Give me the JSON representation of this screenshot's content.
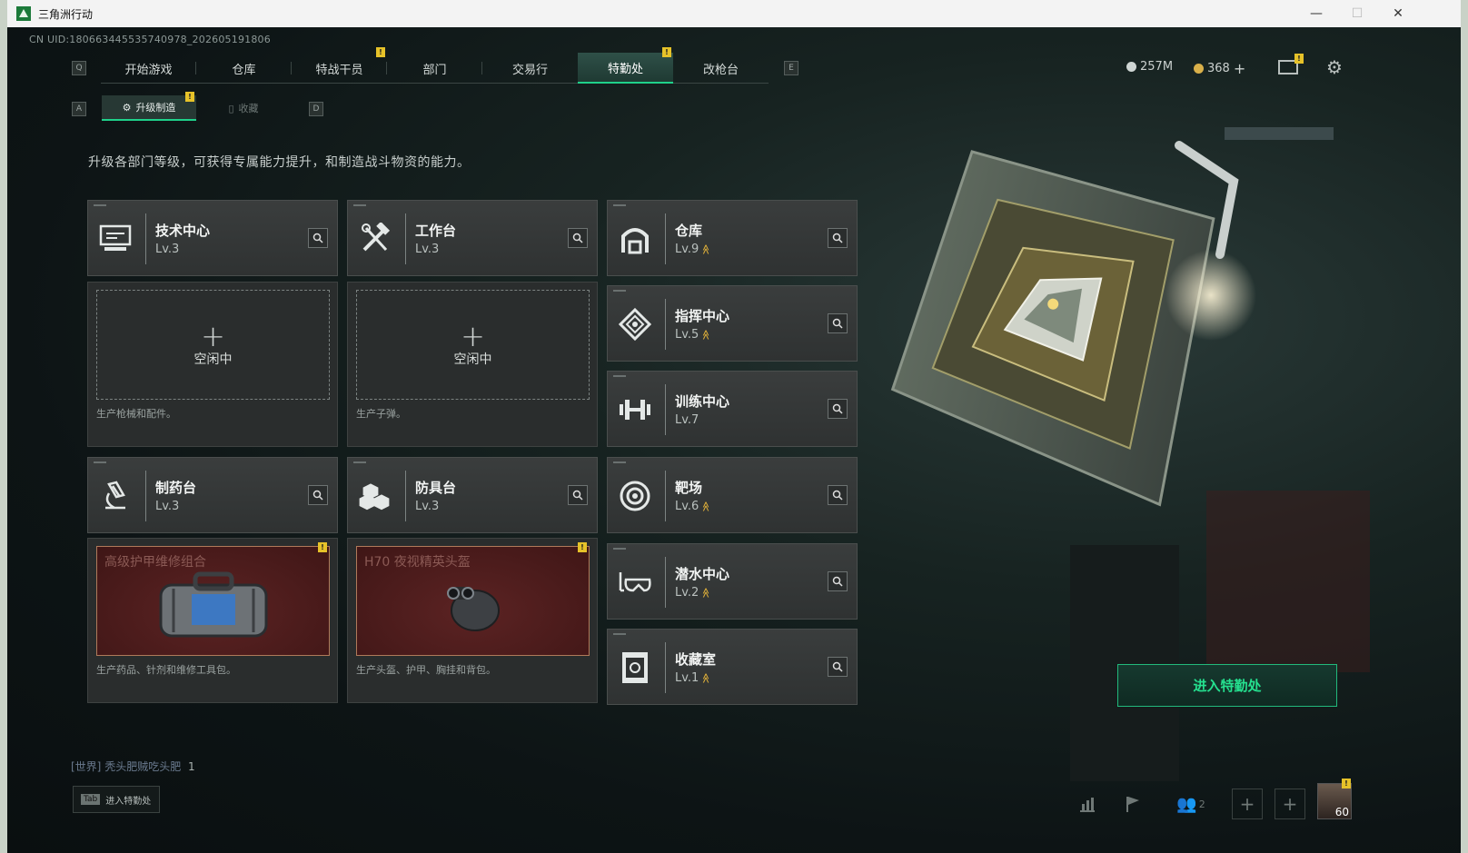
{
  "window": {
    "title": "三角洲行动",
    "minimize": "—",
    "maximize": "☐",
    "close": "✕"
  },
  "uid": "CN UID:18066344553574097​8_202605191806",
  "nav": {
    "left_key": "Q",
    "right_key": "E",
    "tabs": [
      {
        "label": "开始游戏"
      },
      {
        "label": "仓库"
      },
      {
        "label": "特战干员"
      },
      {
        "label": "部门"
      },
      {
        "label": "交易行"
      },
      {
        "label": "特勤处"
      },
      {
        "label": "改枪台"
      }
    ],
    "active_index": 5
  },
  "currency": {
    "coin": "257M",
    "points": "368",
    "plus": "+"
  },
  "badge_mark": "!",
  "subnav": {
    "left_key": "A",
    "right_key": "D",
    "tabs": [
      {
        "label": "升级制造"
      },
      {
        "label": "收藏"
      }
    ]
  },
  "description": "升级各部门等级，可获得专属能力提升，和制造战斗物资的能力。",
  "cards": [
    {
      "name": "技术中心",
      "level": "Lv.3",
      "icon": "monitor-icon",
      "upgrade": false
    },
    {
      "name": "工作台",
      "level": "Lv.3",
      "icon": "tools-icon",
      "upgrade": false
    },
    {
      "name": "仓库",
      "level": "Lv.9",
      "icon": "warehouse-icon",
      "upgrade": true
    },
    {
      "name": "指挥中心",
      "level": "Lv.5",
      "icon": "command-icon",
      "upgrade": true
    },
    {
      "name": "训练中心",
      "level": "Lv.7",
      "icon": "dumbbell-icon",
      "upgrade": false
    },
    {
      "name": "制药台",
      "level": "Lv.3",
      "icon": "microscope-icon",
      "upgrade": false
    },
    {
      "name": "防具台",
      "level": "Lv.3",
      "icon": "armor-icon",
      "upgrade": false
    },
    {
      "name": "靶场",
      "level": "Lv.6",
      "icon": "target-icon",
      "upgrade": true
    },
    {
      "name": "潜水中心",
      "level": "Lv.2",
      "icon": "goggles-icon",
      "upgrade": true
    },
    {
      "name": "收藏室",
      "level": "Lv.1",
      "icon": "vault-icon",
      "upgrade": true
    }
  ],
  "slots": {
    "idle_label": "空闲中",
    "plus": "+",
    "tech_caption": "生产枪械和配件。",
    "workbench_caption": "生产子弹。",
    "pharma_product": "高级护甲维修组合",
    "pharma_caption": "生产药品、针剂和维修工具包。",
    "armor_product": "H70 夜视精英头盔",
    "armor_caption": "生产头盔、护甲、胸挂和背包。"
  },
  "upgrade_mark": "≫",
  "enter_button": "进入特勤处",
  "chat": {
    "channel": "[世界]",
    "user": "秃头肥贼吃头肥",
    "message": "1"
  },
  "tab_hint": {
    "key": "Tab",
    "label": "进入特勤处"
  },
  "friends_count": "2",
  "player_level": "60"
}
